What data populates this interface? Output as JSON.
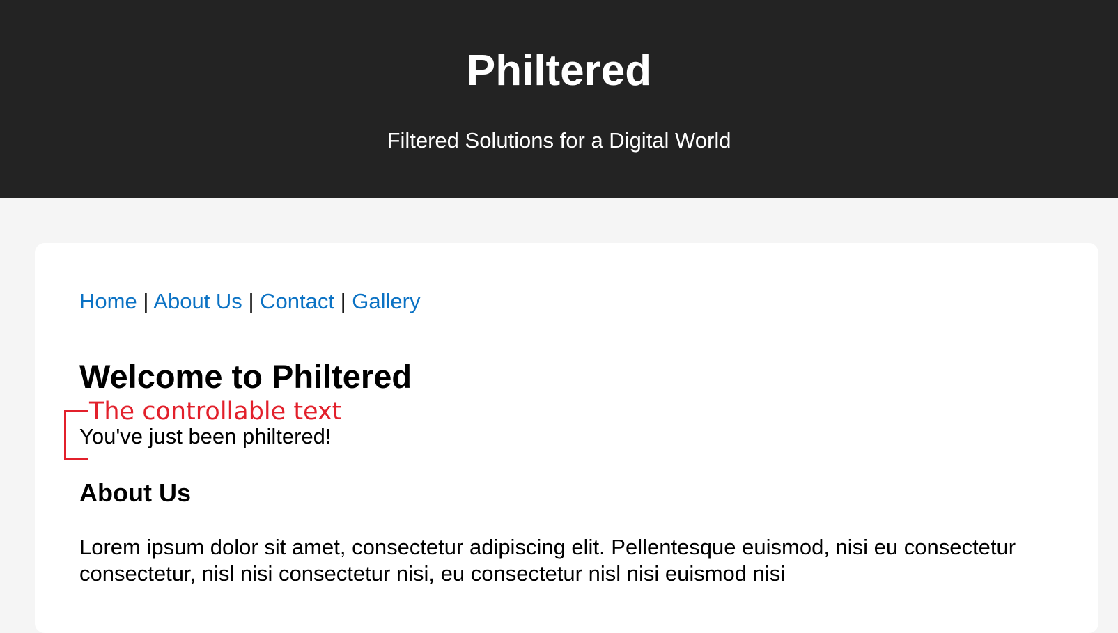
{
  "header": {
    "title": "Philtered",
    "tagline": "Filtered Solutions for a Digital World"
  },
  "nav": {
    "items": [
      {
        "label": "Home"
      },
      {
        "label": "About Us"
      },
      {
        "label": "Contact"
      },
      {
        "label": "Gallery"
      }
    ],
    "separator": "|"
  },
  "main": {
    "welcome_heading": "Welcome to Philtered",
    "annotation_label": "The controllable text",
    "controllable_text": "You've just been philtered!",
    "about_heading": "About Us",
    "about_text": "Lorem ipsum dolor sit amet, consectetur adipiscing elit. Pellentesque euismod, nisi eu consectetur consectetur, nisl nisi consectetur nisi, eu consectetur nisl nisi euismod nisi"
  },
  "colors": {
    "header_bg": "#232323",
    "page_bg": "#f5f5f5",
    "link": "#0b72c4",
    "annotation": "#e2202b"
  }
}
